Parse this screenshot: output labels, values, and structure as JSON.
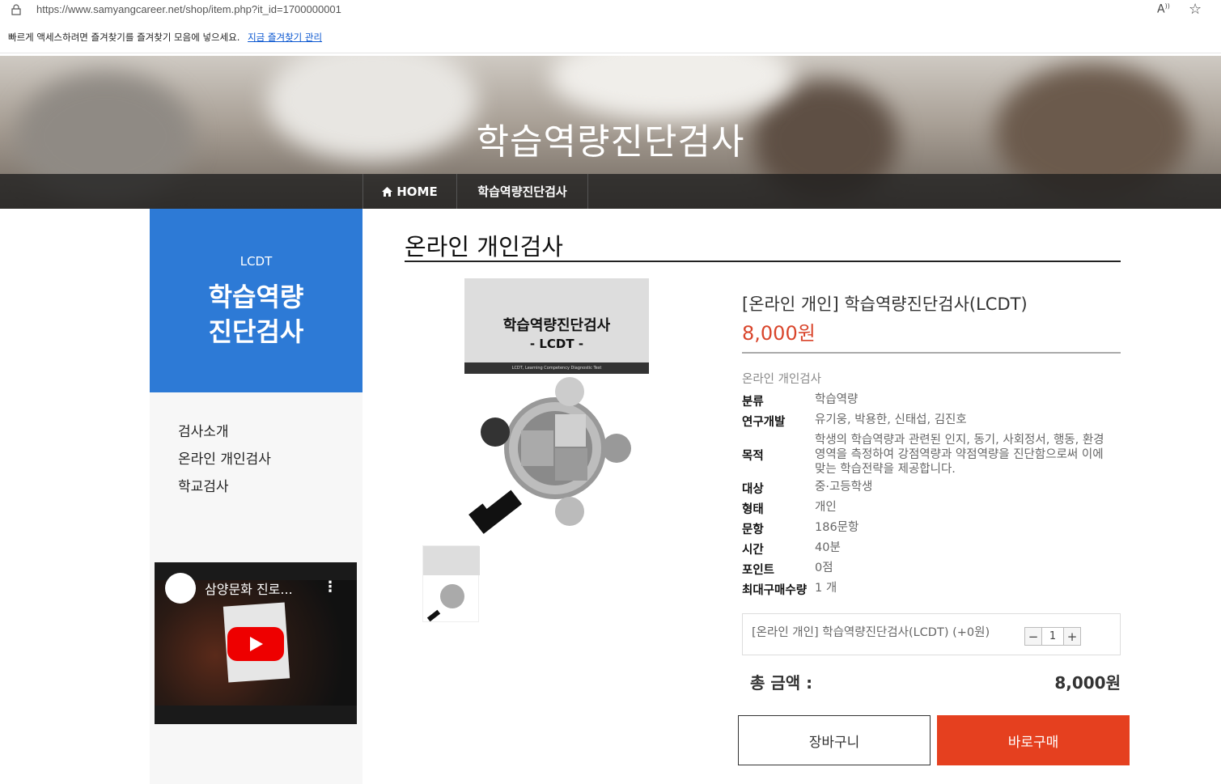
{
  "browser": {
    "url": "https://www.samyangcareer.net/shop/item.php?it_id=1700000001",
    "favorites_message": "빠르게 액세스하려면 즐겨찾기를 즐겨찾기 모음에 넣으세요.",
    "favorites_link": "지금 즐겨찾기 관리",
    "read_aloud_label": "Aͅ"
  },
  "hero": {
    "title": "학습역량진단검사",
    "breadcrumb": [
      {
        "label": "HOME"
      },
      {
        "label": "학습역량진단검사"
      }
    ]
  },
  "sidebar": {
    "subtitle": "LCDT",
    "title_line1": "학습역량",
    "title_line2": "진단검사",
    "menu": [
      {
        "label": "검사소개"
      },
      {
        "label": "온라인 개인검사"
      },
      {
        "label": "학교검사"
      }
    ],
    "video": {
      "title": "삼양문화 진로..."
    }
  },
  "main": {
    "section_title": "온라인 개인검사",
    "cover": {
      "title": "학습역량진단검사",
      "subtitle": "- LCDT -",
      "footer": "LCDT, Learning Competency Diagnostic Test"
    },
    "product": {
      "name": "[온라인 개인] 학습역량진단검사(LCDT)",
      "price": "8,000원",
      "category": "온라인 개인검사",
      "info": [
        {
          "key": "분류",
          "value": "학습역량"
        },
        {
          "key": "연구개발",
          "value": "유기웅, 박용한, 신태섭, 김진호"
        },
        {
          "key": "목적",
          "value": "학생의 학습역량과 관련된 인지, 동기, 사회정서, 행동, 환경 영역을 측정하여 강점역량과 약점역량을 진단함으로써 이에 맞는 학습전략을 제공합니다."
        },
        {
          "key": "대상",
          "value": "중·고등학생"
        },
        {
          "key": "형태",
          "value": "개인"
        },
        {
          "key": "문항",
          "value": "186문항"
        },
        {
          "key": "시간",
          "value": "40분"
        },
        {
          "key": "포인트",
          "value": "0점"
        },
        {
          "key": "최대구매수량",
          "value": "1 개"
        }
      ],
      "option_label": "[온라인 개인] 학습역량진단검사(LCDT) (+0원)",
      "quantity": "1",
      "minus": "−",
      "plus": "+",
      "total_label": "총 금액 :",
      "total_value": "8,000원",
      "cart_button": "장바구니",
      "buy_button": "바로구매"
    }
  },
  "colors": {
    "accent_blue": "#2d7ad6",
    "price_red": "#d9452b",
    "buy_red": "#e5401f"
  }
}
